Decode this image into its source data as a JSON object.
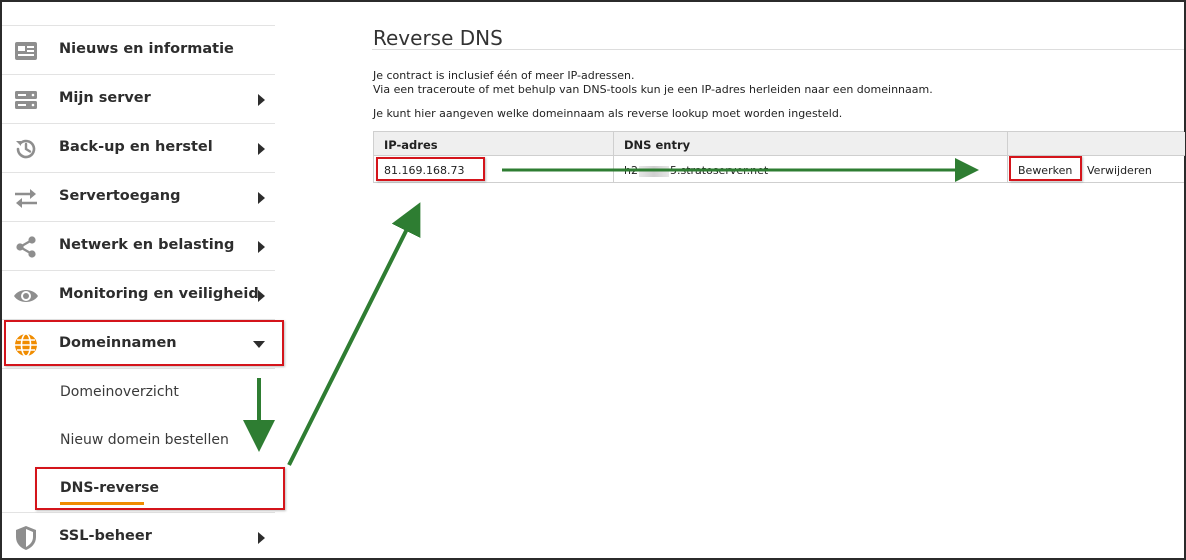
{
  "sidebar": {
    "items": [
      {
        "label": "Nieuws en informatie",
        "icon": "newspaper-icon",
        "has_submenu": false
      },
      {
        "label": "Mijn server",
        "icon": "server-icon",
        "has_submenu": true
      },
      {
        "label": "Back-up en herstel",
        "icon": "history-icon",
        "has_submenu": true
      },
      {
        "label": "Servertoegang",
        "icon": "transfer-arrows-icon",
        "has_submenu": true
      },
      {
        "label": "Netwerk en belasting",
        "icon": "share-icon",
        "has_submenu": true
      },
      {
        "label": "Monitoring en veiligheid",
        "icon": "eye-icon",
        "has_submenu": true
      },
      {
        "label": "Domeinnamen",
        "icon": "globe-icon",
        "has_submenu": true,
        "expanded": true
      },
      {
        "label": "SSL-beheer",
        "icon": "shield-icon",
        "has_submenu": true
      }
    ],
    "subitems": [
      {
        "label": "Domeinoverzicht",
        "active": false
      },
      {
        "label": "Nieuw domein bestellen",
        "active": false
      },
      {
        "label": "DNS-reverse",
        "active": true
      }
    ]
  },
  "main": {
    "title": "Reverse DNS",
    "intro_line1": "Je contract is inclusief één of meer IP-adressen.",
    "intro_line2": "Via een traceroute of met behulp van DNS-tools kun je een IP-adres herleiden naar een domeinnaam.",
    "intro_line3": "Je kunt hier aangeven welke domeinnaam als reverse lookup moet worden ingesteld.",
    "table": {
      "headers": [
        "IP-adres",
        "DNS entry",
        ""
      ],
      "rows": [
        {
          "ip": "81.169.168.73",
          "dns_prefix": "h2",
          "dns_suffix": "5.stratoserver.net",
          "edit_label": "Bewerken",
          "delete_label": "Verwijderen"
        }
      ]
    }
  },
  "colors": {
    "accent_orange": "#f08c00",
    "highlight_red": "#d4141b",
    "arrow_green": "#2e7d32",
    "link_blue": "#1c4f7a"
  }
}
